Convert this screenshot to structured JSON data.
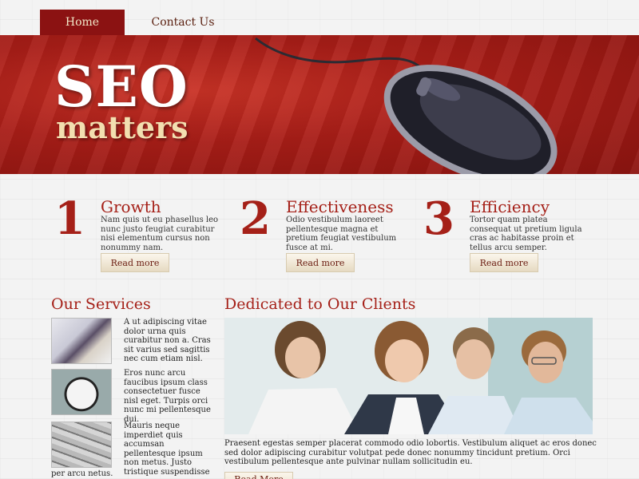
{
  "nav": {
    "items": [
      {
        "label": "Home"
      },
      {
        "label": "Contact Us"
      }
    ]
  },
  "banner": {
    "title": "SEO",
    "subtitle": "matters"
  },
  "features": [
    {
      "number": "1",
      "title": "Growth",
      "text": "Nam quis ut eu phasellus leo nunc justo feugiat curabitur nisi elementum cursus non nonummy nam.",
      "button": "Read more"
    },
    {
      "number": "2",
      "title": "Effectiveness",
      "text": "Odio vestibulum laoreet pellentesque magna et pretium feugiat vestibulum fusce at mi.",
      "button": "Read more"
    },
    {
      "number": "3",
      "title": "Efficiency",
      "text": "Tortor quam platea consequat ut pretium ligula cras ac habitasse proin et tellus arcu semper.",
      "button": "Read more"
    }
  ],
  "services": {
    "title": "Our Services",
    "items": [
      {
        "text": "A ut adipiscing vitae dolor urna quis curabitur non a. Cras sit varius sed sagittis nec cum etiam nisl."
      },
      {
        "text": "Eros nunc arcu faucibus ipsum class consectetuer fusce nisl eget. Turpis orci nunc mi pellentesque dui."
      },
      {
        "text": "Mauris neque imperdiet quis accumsan pellentesque ipsum non metus. Justo tristique suspendisse"
      }
    ],
    "tail": "per arcu netus."
  },
  "clients": {
    "title": "Dedicated to Our Clients",
    "text": "Praesent egestas semper placerat commodo odio lobortis. Vestibulum aliquet ac eros donec sed dolor adipiscing curabitur volutpat pede donec nonummy tincidunt pretium. Orci vestibulum pellentesque ante pulvinar nullam sollicitudin eu.",
    "button": "Read More"
  },
  "colors": {
    "accent": "#a52018",
    "nav_active": "#8b1212",
    "banner": "#b22219"
  }
}
